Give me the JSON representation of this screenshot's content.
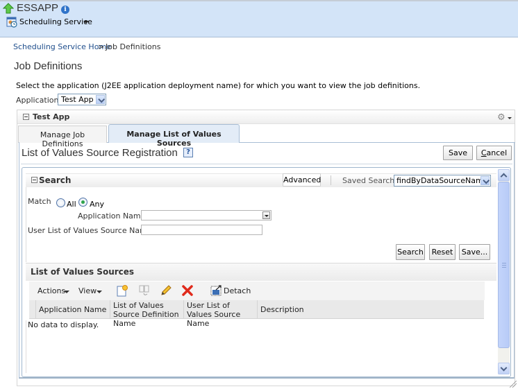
{
  "header": {
    "app_title": "ESSAPP",
    "service_menu": "Scheduling Service"
  },
  "breadcrumb": {
    "home": "Scheduling Service Home",
    "separator": ">",
    "current": "Job Definitions"
  },
  "page": {
    "title": "Job Definitions",
    "instruction": "Select the application (J2EE application deployment name) for which you want to view the job definitions.",
    "application_label": "Application",
    "application_value": "Test App"
  },
  "panel": {
    "title": "Test App",
    "tabs": [
      {
        "label": "Manage Job Definitions",
        "active": false
      },
      {
        "label": "Manage List of Values Sources",
        "active": true
      }
    ]
  },
  "registration": {
    "title": "List of Values Source Registration",
    "help": "?",
    "save_label": "Save",
    "cancel_label": "Cancel"
  },
  "search": {
    "title": "Search",
    "advanced_label": "Advanced",
    "saved_search_label": "Saved Search",
    "saved_search_value": "findByDataSourceName",
    "match_label": "Match",
    "match_options": [
      {
        "label": "All",
        "selected": false
      },
      {
        "label": "Any",
        "selected": true
      }
    ],
    "fields": [
      {
        "label": "Application Name",
        "value": ""
      },
      {
        "label": "User List of Values Source Name",
        "value": ""
      }
    ],
    "buttons": {
      "search": "Search",
      "reset": "Reset",
      "save": "Save..."
    }
  },
  "list": {
    "title": "List of Values Sources",
    "toolbar": {
      "actions": "Actions",
      "view": "View",
      "icons": [
        "create-icon",
        "duplicate-icon",
        "edit-icon",
        "delete-icon",
        "detach-icon"
      ],
      "detach": "Detach"
    },
    "columns": [
      "Application Name",
      "List of Values Source Definition Name",
      "User List of Values Source Name",
      "Description"
    ],
    "empty_message": "No data to display."
  }
}
